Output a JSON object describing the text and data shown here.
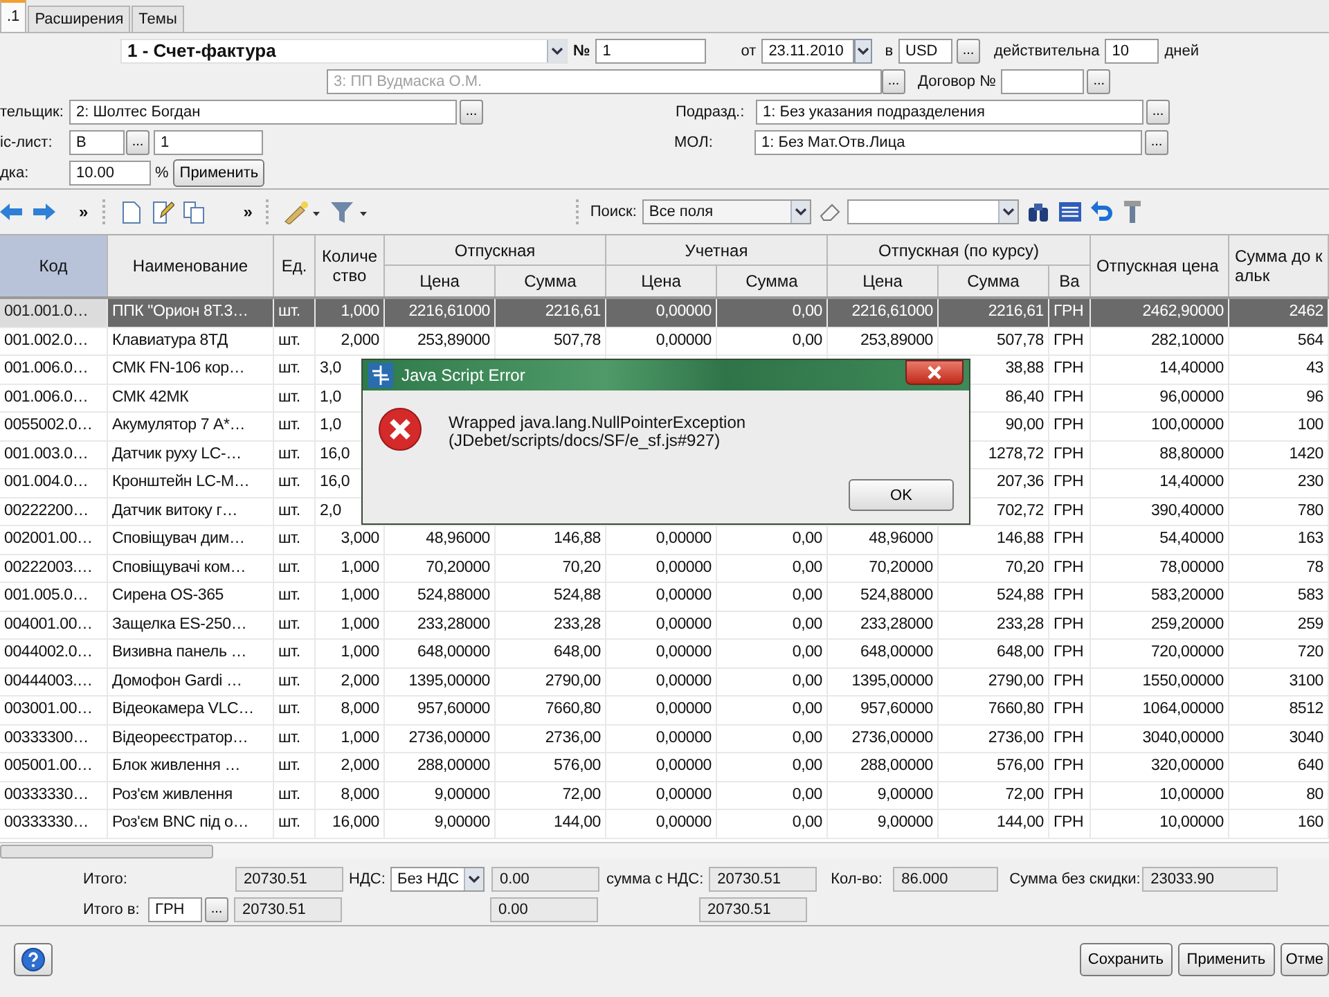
{
  "tabs": [
    {
      "label": ".1",
      "selected": true
    },
    {
      "label": "Расширения",
      "selected": false
    },
    {
      "label": "Темы",
      "selected": false
    }
  ],
  "form": {
    "doc_type": "1 - Счет-фактура",
    "number_label": "№",
    "number": "1",
    "date_label": "от",
    "date": "23.11.2010",
    "currency_label": "в",
    "currency": "USD",
    "currency_button": "...",
    "valid_label": "действительна",
    "valid_days": "10",
    "days_label": "дней",
    "firm": "3: ПП Вудмаска О.М.",
    "firm_disabled": true,
    "firm_button": "...",
    "contract_label": "Договор №",
    "contract_button": "...",
    "buyer_label": "тельщик:",
    "buyer": "2: Шолтес Богдан",
    "buyer_button": "...",
    "dept_label": "Подразд.:",
    "dept": "1: Без указания подразделения",
    "dept_button": "...",
    "price_list_label": "іс-лист:",
    "price_list": "В",
    "price_list_button": "...",
    "price_list_number": "1",
    "mol_label": "МОЛ:",
    "mol": "1: Без Мат.Отв.Лица",
    "mol_button": "...",
    "discount_label": "дка:",
    "discount": "10.00",
    "percent": "%",
    "apply": "Применить"
  },
  "toolbar": {
    "overflow": [
      "»",
      "»"
    ],
    "search_label": "Поиск:",
    "search_scope": "Все поля"
  },
  "columns": [
    {
      "label": "Код",
      "sorted": true
    },
    {
      "label": "Наименование",
      "sorted": false
    },
    {
      "label": "Ед.",
      "sorted": false
    },
    {
      "label": "Количество",
      "sorted": false
    },
    {
      "label": "Отпускная",
      "sorted": false,
      "sub": [
        "Цена",
        "Сумма"
      ]
    },
    {
      "label": "Учетная",
      "sorted": false,
      "sub": [
        "Цена",
        "Сумма"
      ]
    },
    {
      "label": "Отпускная (по курсу)",
      "sorted": false,
      "sub": [
        "Цена",
        "Сумма",
        "Ва"
      ]
    },
    {
      "label": "Отпускная цена",
      "sorted": false
    },
    {
      "label": "Сумма до кальк",
      "sorted": false
    }
  ],
  "rows": [
    {
      "selected": true,
      "covered": false,
      "cells": [
        "001.001.0…",
        "ППК \"Орион 8Т.3…",
        "шт.",
        "1,000",
        "2216,61000",
        "2216,61",
        "0,00000",
        "0,00",
        "2216,61000",
        "2216,61",
        "ГРН",
        "2462,90000",
        "2462"
      ]
    },
    {
      "selected": false,
      "covered": false,
      "cells": [
        "001.002.0…",
        "Клавиатура 8ТД",
        "шт.",
        "2,000",
        "253,89000",
        "507,78",
        "0,00000",
        "0,00",
        "253,89000",
        "507,78",
        "ГРН",
        "282,10000",
        "564"
      ]
    },
    {
      "selected": false,
      "covered": true,
      "cells": [
        "001.006.0…",
        "СМК FN-106 кор…",
        "шт.",
        "3,0",
        null,
        null,
        null,
        null,
        null,
        "38,88",
        "ГРН",
        "14,40000",
        "43"
      ]
    },
    {
      "selected": false,
      "covered": true,
      "cells": [
        "001.006.0…",
        "СМК 42МК",
        "шт.",
        "1,0",
        null,
        null,
        null,
        null,
        null,
        "86,40",
        "ГРН",
        "96,00000",
        "96"
      ]
    },
    {
      "selected": false,
      "covered": true,
      "cells": [
        "0055002.0…",
        "Акумулятор 7 А*…",
        "шт.",
        "1,0",
        null,
        null,
        null,
        null,
        null,
        "90,00",
        "ГРН",
        "100,00000",
        "100"
      ]
    },
    {
      "selected": false,
      "covered": true,
      "cells": [
        "001.003.0…",
        "Датчик руху LC-…",
        "шт.",
        "16,0",
        null,
        null,
        null,
        null,
        null,
        "1278,72",
        "ГРН",
        "88,80000",
        "1420"
      ]
    },
    {
      "selected": false,
      "covered": true,
      "cells": [
        "001.004.0…",
        "Кронштейн LC-М…",
        "шт.",
        "16,0",
        null,
        null,
        null,
        null,
        null,
        "207,36",
        "ГРН",
        "14,40000",
        "230"
      ]
    },
    {
      "selected": false,
      "covered": true,
      "cells": [
        "00222200…",
        "Датчик витоку г…",
        "шт.",
        "2,0",
        null,
        null,
        null,
        null,
        null,
        "702,72",
        "ГРН",
        "390,40000",
        "780"
      ]
    },
    {
      "selected": false,
      "covered": false,
      "cells": [
        "002001.00…",
        "Сповіщувач дим…",
        "шт.",
        "3,000",
        "48,96000",
        "146,88",
        "0,00000",
        "0,00",
        "48,96000",
        "146,88",
        "ГРН",
        "54,40000",
        "163"
      ]
    },
    {
      "selected": false,
      "covered": false,
      "cells": [
        "00222003.…",
        "Сповіщувачі ком…",
        "шт.",
        "1,000",
        "70,20000",
        "70,20",
        "0,00000",
        "0,00",
        "70,20000",
        "70,20",
        "ГРН",
        "78,00000",
        "78"
      ]
    },
    {
      "selected": false,
      "covered": false,
      "cells": [
        "001.005.0…",
        "Сирена OS-365",
        "шт.",
        "1,000",
        "524,88000",
        "524,88",
        "0,00000",
        "0,00",
        "524,88000",
        "524,88",
        "ГРН",
        "583,20000",
        "583"
      ]
    },
    {
      "selected": false,
      "covered": false,
      "cells": [
        "004001.00…",
        "Защелка ES-250…",
        "шт.",
        "1,000",
        "233,28000",
        "233,28",
        "0,00000",
        "0,00",
        "233,28000",
        "233,28",
        "ГРН",
        "259,20000",
        "259"
      ]
    },
    {
      "selected": false,
      "covered": false,
      "cells": [
        "0044002.0…",
        "Визивна панель …",
        "шт.",
        "1,000",
        "648,00000",
        "648,00",
        "0,00000",
        "0,00",
        "648,00000",
        "648,00",
        "ГРН",
        "720,00000",
        "720"
      ]
    },
    {
      "selected": false,
      "covered": false,
      "cells": [
        "00444003.…",
        "Домофон Gardi …",
        "шт.",
        "2,000",
        "1395,00000",
        "2790,00",
        "0,00000",
        "0,00",
        "1395,00000",
        "2790,00",
        "ГРН",
        "1550,00000",
        "3100"
      ]
    },
    {
      "selected": false,
      "covered": false,
      "cells": [
        "003001.00…",
        "Відеокамера VLC…",
        "шт.",
        "8,000",
        "957,60000",
        "7660,80",
        "0,00000",
        "0,00",
        "957,60000",
        "7660,80",
        "ГРН",
        "1064,00000",
        "8512"
      ]
    },
    {
      "selected": false,
      "covered": false,
      "cells": [
        "00333300…",
        "Відеореєстратор…",
        "шт.",
        "1,000",
        "2736,00000",
        "2736,00",
        "0,00000",
        "0,00",
        "2736,00000",
        "2736,00",
        "ГРН",
        "3040,00000",
        "3040"
      ]
    },
    {
      "selected": false,
      "covered": false,
      "cells": [
        "005001.00…",
        "Блок живлення …",
        "шт.",
        "2,000",
        "288,00000",
        "576,00",
        "0,00000",
        "0,00",
        "288,00000",
        "576,00",
        "ГРН",
        "320,00000",
        "640"
      ]
    },
    {
      "selected": false,
      "covered": false,
      "cells": [
        "00333330…",
        "Роз'єм живлення",
        "шт.",
        "8,000",
        "9,00000",
        "72,00",
        "0,00000",
        "0,00",
        "9,00000",
        "72,00",
        "ГРН",
        "10,00000",
        "80"
      ]
    },
    {
      "selected": false,
      "covered": false,
      "cells": [
        "00333330…",
        "Роз'єм BNC під о…",
        "шт.",
        "16,000",
        "9,00000",
        "144,00",
        "0,00000",
        "0,00",
        "9,00000",
        "144,00",
        "ГРН",
        "10,00000",
        "160"
      ]
    }
  ],
  "totals": {
    "total_label": "Итого:",
    "total": "20730.51",
    "vat_label": "НДС:",
    "vat_mode": "Без НДС",
    "vat": "0.00",
    "with_vat_label": "сумма с НДС:",
    "with_vat": "20730.51",
    "qty_label": "Кол-во:",
    "qty": "86.000",
    "no_discount_label": "Сумма без скидки:",
    "no_discount": "23033.90",
    "total_in_label": "Итого в:",
    "total_in_currency": "ГРН",
    "total_in_button": "...",
    "total_in": "20730.51",
    "vat_in": "0.00",
    "with_vat_in": "20730.51"
  },
  "buttons": [
    "Сохранить",
    "Применить",
    "Отме"
  ],
  "dialog": {
    "title": "Java Script Error",
    "message": [
      "Wrapped java.lang.NullPointerException",
      "(JDebet/scripts/docs/SF/e_sf.js#927)"
    ],
    "ok": "OK"
  }
}
